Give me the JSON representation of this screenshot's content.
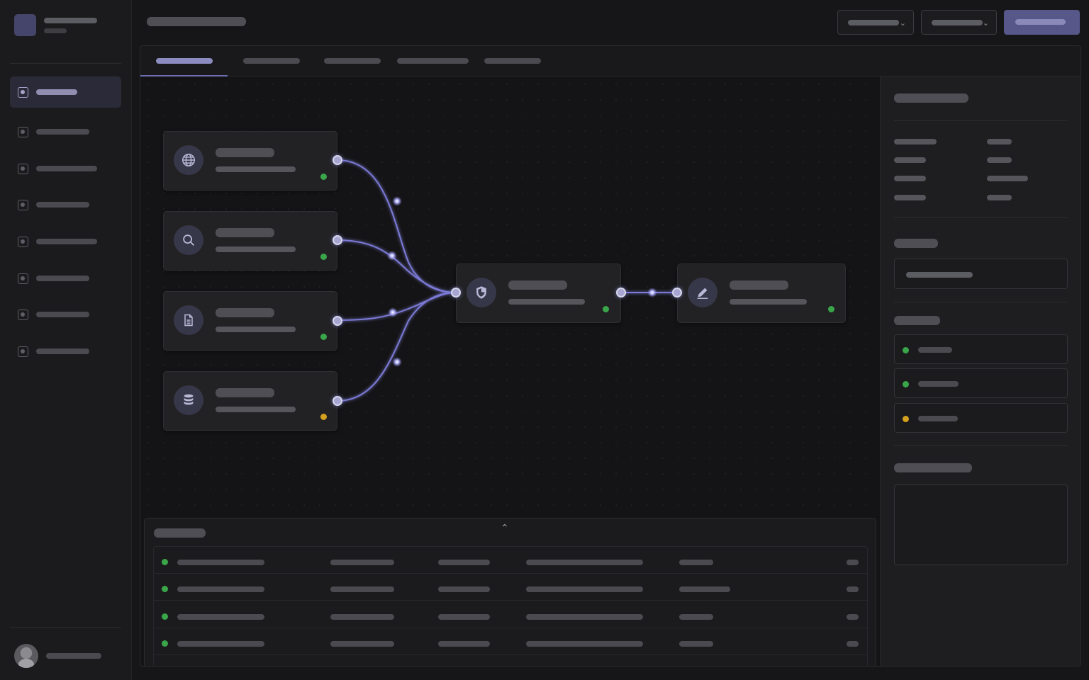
{
  "app": {
    "title": "",
    "user_name": ""
  },
  "sidebar": {
    "items": [
      {
        "label": "",
        "icon": "workflow-icon",
        "active": true
      },
      {
        "label": "",
        "icon": "workflow-icon"
      },
      {
        "label": "",
        "icon": "workflow-icon"
      },
      {
        "label": "",
        "icon": "workflow-icon"
      },
      {
        "label": "",
        "icon": "workflow-icon"
      },
      {
        "label": "",
        "icon": "workflow-icon"
      },
      {
        "label": "",
        "icon": "workflow-icon"
      },
      {
        "label": "",
        "icon": "workflow-icon"
      }
    ]
  },
  "header": {
    "page_title": "",
    "select_1": "",
    "select_2": "",
    "primary_action": ""
  },
  "tabs": [
    {
      "label": "",
      "active": true
    },
    {
      "label": ""
    },
    {
      "label": ""
    },
    {
      "label": ""
    },
    {
      "label": ""
    }
  ],
  "flow": {
    "source_nodes": [
      {
        "icon": "globe-icon",
        "title": "",
        "subtitle": "",
        "status": "ok"
      },
      {
        "icon": "search-icon",
        "title": "",
        "subtitle": "",
        "status": "ok"
      },
      {
        "icon": "document-icon",
        "title": "",
        "subtitle": "",
        "status": "ok"
      },
      {
        "icon": "database-icon",
        "title": "",
        "subtitle": "",
        "status": "warning"
      }
    ],
    "process_node": {
      "icon": "shield-icon",
      "title": "",
      "subtitle": "",
      "status": "ok"
    },
    "output_node": {
      "icon": "pencil-icon",
      "title": "",
      "subtitle": "",
      "status": "ok"
    }
  },
  "log": {
    "title": "",
    "rows": [
      {
        "status": "ok",
        "cells": [
          "",
          "",
          "",
          "",
          "",
          ""
        ]
      },
      {
        "status": "ok",
        "cells": [
          "",
          "",
          "",
          "",
          "",
          ""
        ]
      },
      {
        "status": "ok",
        "cells": [
          "",
          "",
          "",
          "",
          "",
          ""
        ]
      },
      {
        "status": "ok",
        "cells": [
          "",
          "",
          "",
          "",
          "",
          ""
        ]
      },
      {
        "status": "warning",
        "cells": [
          "",
          "",
          "",
          "",
          "",
          ""
        ]
      }
    ]
  },
  "inspector": {
    "title": "",
    "properties": [
      {
        "key": "",
        "value": ""
      },
      {
        "key": "",
        "value": ""
      },
      {
        "key": "",
        "value": ""
      },
      {
        "key": "",
        "value": ""
      }
    ],
    "field_label": "",
    "field_value": "",
    "status_label": "",
    "status_items": [
      {
        "label": "",
        "status": "ok"
      },
      {
        "label": "",
        "status": "ok"
      },
      {
        "label": "",
        "status": "warning"
      }
    ],
    "notes_label": "",
    "notes_value": ""
  },
  "colors": {
    "accent": "#6e6db0",
    "edge": "#7b7ad6",
    "status_ok": "#3aa64a",
    "status_warning": "#d4a21f",
    "background": "#161618"
  }
}
